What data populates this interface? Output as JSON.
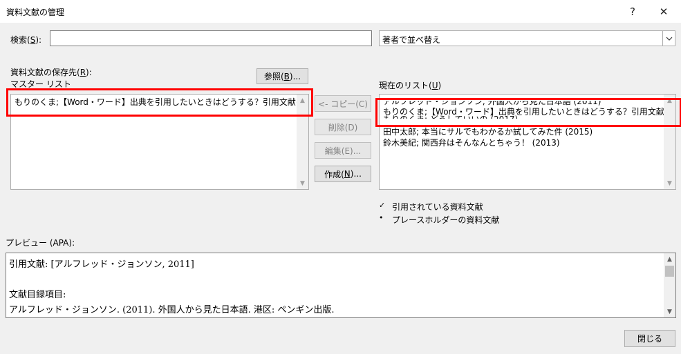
{
  "window": {
    "title": "資料文献の管理",
    "help_label": "?",
    "close_label": "✕"
  },
  "search": {
    "label_before": "検索(",
    "label_key": "S",
    "label_after": "):",
    "value": ""
  },
  "sort": {
    "selected": "著者で並べ替え"
  },
  "source": {
    "label_before": "資料文献の保存先(",
    "label_key": "R",
    "label_after": "):",
    "master_list_label": "マスター リスト",
    "browse_before": "参照(",
    "browse_key": "B",
    "browse_after": ")...",
    "items": [
      "もりのくま;【Word・ワード】出典を引用したいときはどうする？引用文献の挿入 (2020)"
    ]
  },
  "buttons": {
    "copy": "<- コピー(C)",
    "delete": "削除(D)",
    "edit": "編集(E)...",
    "create_before": "作成(",
    "create_key": "N",
    "create_after": ")...",
    "close": "閉じる"
  },
  "current": {
    "label_before": "現在のリスト(",
    "label_key": "U",
    "label_after": ")",
    "items": [
      "アルフレッド・ジョンソン; 外国人から見た日本語 (2011)",
      "もりのくま;【Word・ワード】出典を引用したいときはどうする？引用文献の挿入 (2020)",
      "もりのくま; どうしていいの (2017)",
      "田中太郎; 本当にサルでもわかるか試してみた件 (2015)",
      "鈴木美紀; 関西弁はそんなんとちゃう！ (2013)"
    ]
  },
  "legend": {
    "cited_mark": "✓",
    "cited_label": "引用されている資料文献",
    "placeholder_mark": "•",
    "placeholder_label": "プレースホルダーの資料文献"
  },
  "preview": {
    "label": "プレビュー (APA):",
    "lines": [
      "引用文献:   [アルフレッド・ジョンソン, 2011]",
      "",
      "文献目録項目:",
      "アルフレッド・ジョンソン. (2011). 外国人から見た日本語. 港区: ペンギン出版."
    ]
  },
  "colors": {
    "highlight": "#ff0000",
    "dialog_bg": "#f0f0f0"
  }
}
